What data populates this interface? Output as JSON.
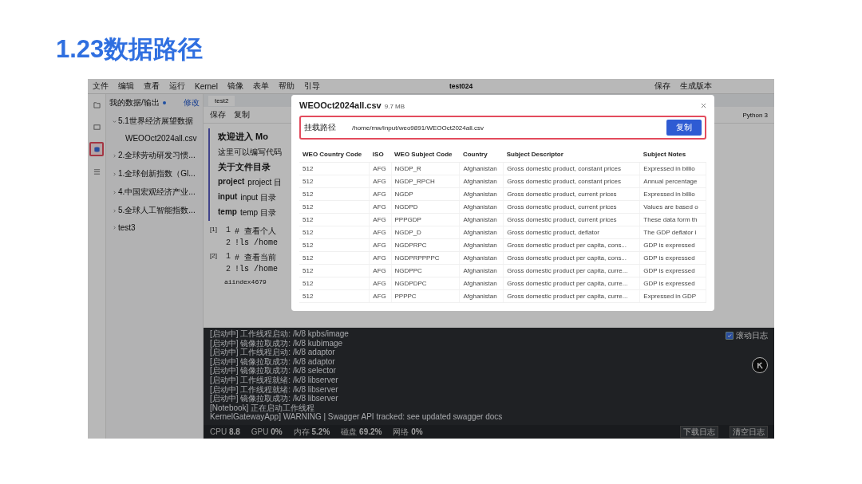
{
  "slide_title": "1.23数据路径",
  "menu": [
    "文件",
    "编辑",
    "查看",
    "运行",
    "Kernel",
    "镜像",
    "表单",
    "帮助",
    "引导"
  ],
  "window": {
    "title": "test024",
    "actions": [
      "保存",
      "生成版本"
    ]
  },
  "rail": [
    {
      "kind": "files",
      "selected": false
    },
    {
      "kind": "box",
      "selected": false
    },
    {
      "kind": "database",
      "selected": true
    },
    {
      "kind": "list",
      "selected": false
    }
  ],
  "sidebar": {
    "title": "我的数据/输出",
    "action": "修改",
    "items": [
      {
        "label": "5.1世界经济展望数据",
        "expanded": true,
        "children": [
          {
            "label": "WEOOct2024all.csv"
          }
        ]
      },
      {
        "label": "2.全球劳动研发习惯...",
        "expanded": false
      },
      {
        "label": "1.全球创新指数（Gl...",
        "expanded": false
      },
      {
        "label": "4.中国宏观经济产业...",
        "expanded": false
      },
      {
        "label": "5.全球人工智能指数...",
        "expanded": false
      },
      {
        "label": "test3",
        "expanded": false
      }
    ]
  },
  "notebook": {
    "tab": "test2",
    "kernel": "Python 3",
    "toolbar": [
      "保存",
      "复制"
    ],
    "markdown": {
      "heading": "欢迎进入 Mo",
      "intro": "这里可以编写代码",
      "subheading": "关于文件目录",
      "dirs": [
        {
          "name": "project",
          "text": "project 目"
        },
        {
          "name": "input",
          "text": "input 目录"
        },
        {
          "name": "temp",
          "text": "temp 目录"
        }
      ]
    },
    "cells": [
      {
        "prompt": "[1]",
        "lines": [
          {
            "no": "1",
            "code": "# 查看个人"
          },
          {
            "no": "2",
            "code": "!ls /home"
          }
        ]
      },
      {
        "prompt": "[2]",
        "lines": [
          {
            "no": "1",
            "code": "# 查看当前"
          },
          {
            "no": "2",
            "code": "!ls /home"
          }
        ]
      }
    ],
    "output": "aiindex4679"
  },
  "logs": {
    "lines": [
      "[启动中] 工作线程启动: /k/8 kpbs/image",
      "[启动中] 镜像拉取成功: /k/8 kubimage",
      "[启动中] 工作线程启动: /k/8 adaptor",
      "[启动中] 镜像拉取成功: /k/8 adaptor",
      "[启动中] 镜像拉取成功: /k/8 selector",
      "[启动中] 工作线程就绪: /k/8 libserver",
      "[启动中] 工作线程就绪: /k/8 libserver",
      "[启动中] 镜像拉取成功: /k/8 libserver",
      "[Notebook] 正在启动工作线程",
      "KernelGatewayApp] WARNING | Swagger API tracked: see updated swagger docs"
    ],
    "scroll": {
      "label": "滚动日志",
      "checked": true
    }
  },
  "status_bar": {
    "metrics": [
      {
        "name": "CPU",
        "value": "8.8"
      },
      {
        "name": "GPU",
        "value": "0%"
      },
      {
        "name": "内存",
        "value": "5.2%"
      },
      {
        "name": "磁盘",
        "value": "69.2%"
      },
      {
        "name": "网络",
        "value": "0%"
      }
    ],
    "buttons": [
      "下载日志",
      "清空日志"
    ]
  },
  "modal": {
    "title": "WEOOct2024all.csv",
    "size": "9.7 MB",
    "path_label": "挂载路径",
    "path": "/home/mw/input/weo9891/WEOOct2024all.csv",
    "copy_button": "复制",
    "table": {
      "columns": [
        "WEO Country Code",
        "ISO",
        "WEO Subject Code",
        "Country",
        "Subject Descriptor",
        "Subject Notes"
      ],
      "rows": [
        [
          "512",
          "AFG",
          "NGDP_R",
          "Afghanistan",
          "Gross domestic product, constant prices",
          "Expressed in billio"
        ],
        [
          "512",
          "AFG",
          "NGDP_RPCH",
          "Afghanistan",
          "Gross domestic product, constant prices",
          "Annual percentage"
        ],
        [
          "512",
          "AFG",
          "NGDP",
          "Afghanistan",
          "Gross domestic product, current prices",
          "Expressed in billio"
        ],
        [
          "512",
          "AFG",
          "NGDPD",
          "Afghanistan",
          "Gross domestic product, current prices",
          "Values are based o"
        ],
        [
          "512",
          "AFG",
          "PPPGDP",
          "Afghanistan",
          "Gross domestic product, current prices",
          "These data form th"
        ],
        [
          "512",
          "AFG",
          "NGDP_D",
          "Afghanistan",
          "Gross domestic product, deflator",
          "The GDP deflator i"
        ],
        [
          "512",
          "AFG",
          "NGDPRPC",
          "Afghanistan",
          "Gross domestic product per capita, cons...",
          "GDP is expressed"
        ],
        [
          "512",
          "AFG",
          "NGDPRPPPPC",
          "Afghanistan",
          "Gross domestic product per capita, cons...",
          "GDP is expressed"
        ],
        [
          "512",
          "AFG",
          "NGDPPC",
          "Afghanistan",
          "Gross domestic product per capita, curre...",
          "GDP is expressed"
        ],
        [
          "512",
          "AFG",
          "NGDPDPC",
          "Afghanistan",
          "Gross domestic product per capita, curre...",
          "GDP is expressed"
        ],
        [
          "512",
          "AFG",
          "PPPPC",
          "Afghanistan",
          "Gross domestic product per capita, curre...",
          "Expressed in GDP"
        ]
      ]
    }
  }
}
